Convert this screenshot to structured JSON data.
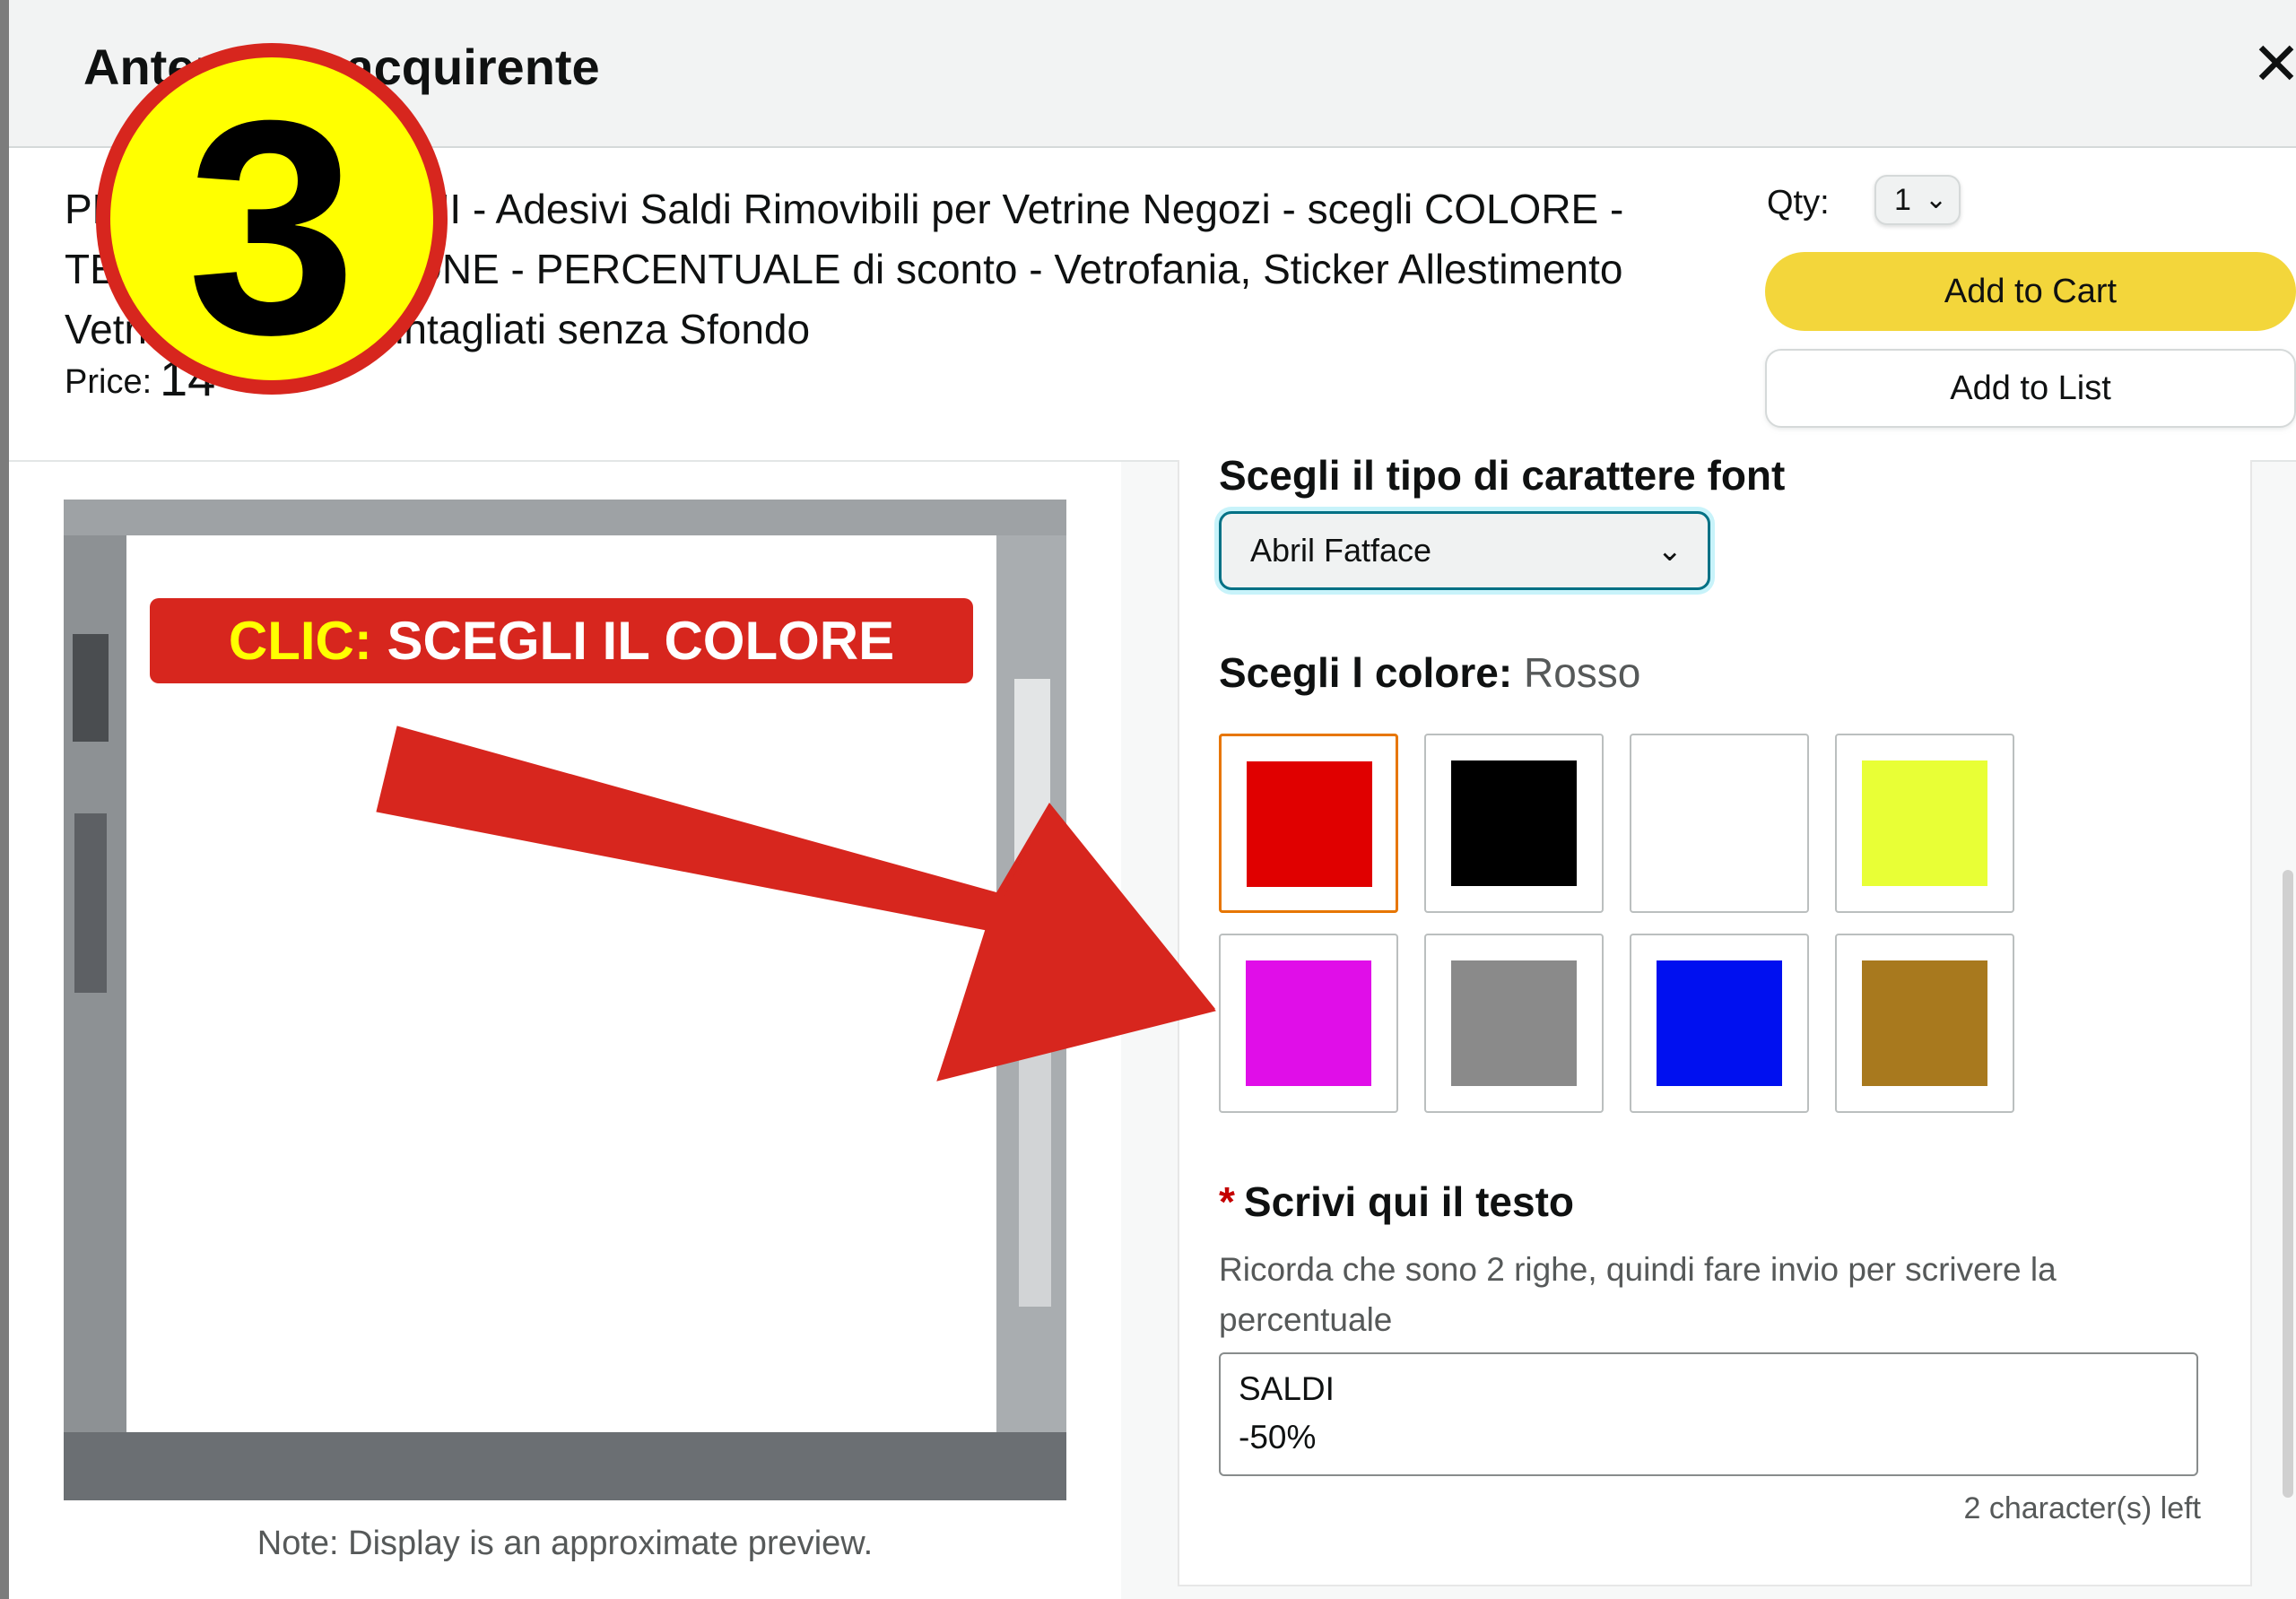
{
  "modal": {
    "title": "Anteprima acquirente",
    "close_glyph": "✕"
  },
  "product": {
    "title": "PERSONALIZZA QUI - Adesivi Saldi Rimovibili per Vetrine Negozi - scegli COLORE - TESTO - DIMENSIONE - PERCENTUALE di sconto - Vetrofania, Sticker Allestimento Vetrine Decorate. intagliati senza Sfondo",
    "price_label": "Price:",
    "price_value": "14",
    "qty_label": "Qty:",
    "qty_value": "1",
    "add_to_cart": "Add to Cart",
    "add_to_list": "Add to List"
  },
  "preview": {
    "note": "Note: Display is an approximate preview."
  },
  "options": {
    "font_heading": "Scegli il tipo di carattere font",
    "font_selected": "Abril Fatface",
    "color_heading_label": "Scegli l colore:",
    "color_selected": "Rosso",
    "swatches": [
      {
        "color": "#e00000",
        "selected": true
      },
      {
        "color": "#000000",
        "selected": false
      },
      {
        "color": "#ffffff",
        "selected": false
      },
      {
        "color": "#e8ff36",
        "selected": false
      },
      {
        "color": "#e00ee8",
        "selected": false
      },
      {
        "color": "#8a8a8a",
        "selected": false
      },
      {
        "color": "#0010f0",
        "selected": false
      },
      {
        "color": "#a8791e",
        "selected": false
      }
    ],
    "text_required_mark": "*",
    "text_heading": "Scrivi qui il testo",
    "text_help": "Ricorda che sono 2 righe, quindi fare invio per scrivere la percentuale",
    "text_value": "SALDI\n-50%",
    "chars_left": "2 character(s) left"
  },
  "overlay": {
    "step_number": "3",
    "callout_accent": "CLIC:",
    "callout_text": "SCEGLI IL COLORE"
  },
  "icons": {
    "chevron": "chevron-down-icon",
    "close": "close-icon"
  }
}
